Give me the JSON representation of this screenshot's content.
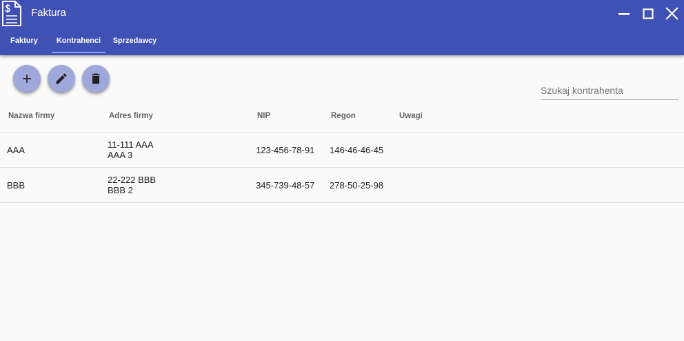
{
  "window": {
    "title": "Faktura",
    "icon": "invoice-document-icon",
    "controls": [
      "minimize-icon",
      "maximize-icon",
      "close-icon"
    ]
  },
  "tabs": [
    {
      "label": "Faktury",
      "active": false
    },
    {
      "label": "Kontrahenci",
      "active": true
    },
    {
      "label": "Sprzedawcy",
      "active": false
    }
  ],
  "toolbar": {
    "buttons": [
      {
        "icon": "plus-icon"
      },
      {
        "icon": "pencil-icon"
      },
      {
        "icon": "trash-icon"
      }
    ]
  },
  "search": {
    "placeholder": "Szukaj kontrahenta",
    "value": ""
  },
  "table": {
    "columns": [
      "Nazwa firmy",
      "Adres firmy",
      "NIP",
      "Regon",
      "Uwagi"
    ],
    "rows": [
      {
        "name": "AAA",
        "address": [
          "11-111 AAA",
          "AAA 3"
        ],
        "nip": "123-456-78-91",
        "regon": "146-46-46-45",
        "notes": ""
      },
      {
        "name": "BBB",
        "address": [
          "22-222 BBB",
          "BBB 2"
        ],
        "nip": "345-739-48-57",
        "regon": "278-50-25-98",
        "notes": ""
      }
    ]
  },
  "colors": {
    "primary": "#3F51B5",
    "fab": "#9FA8DA",
    "background": "#FAFAFA",
    "divider": "#E0E0E0",
    "tab_indicator": "#8C9EFF"
  }
}
